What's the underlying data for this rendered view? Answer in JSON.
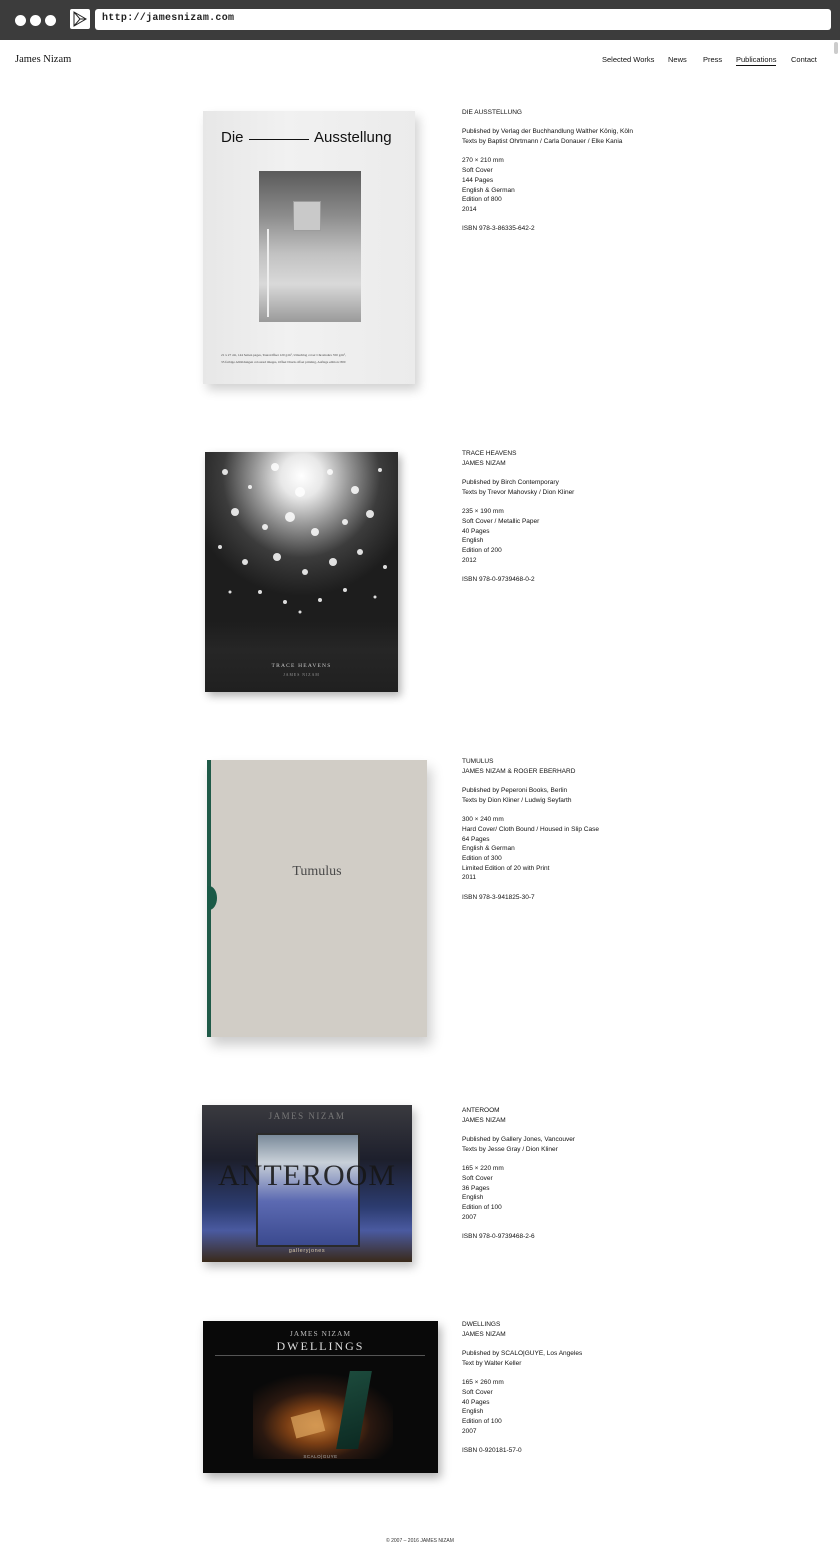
{
  "browser": {
    "url": "http://jamesnizam.com"
  },
  "site": {
    "brand": "James Nizam"
  },
  "nav": {
    "items": [
      "Selected Works",
      "News",
      "Press",
      "Publications",
      "Contact"
    ],
    "active": "Publications"
  },
  "publications": [
    {
      "cover": {
        "title_left": "Die",
        "title_right": "Ausstellung",
        "colophon_line1": "21 x 27 cm, 144 Seiten pages, TauroOffset 120 g/m², Umschlag cover Chromolux 350 g/m²,",
        "colophon_line2": "35 farbige Abbildungen coloured images, Offset Druck offset printing, Auflage edition: 800"
      },
      "title": "DIE AUSSTELLUNG",
      "author": "",
      "publisher": "Published by Verlag der Buchhandlung Walther König, Köln",
      "texts": "Texts by Baptist Ohrtmann / Carla Donauer / Elke Kania",
      "specs": [
        "270 × 210 mm",
        "Soft Cover",
        "144 Pages",
        "English & German",
        "Edition of 800",
        "2014"
      ],
      "isbn": "ISBN 978-3-86335-642-2"
    },
    {
      "cover": {
        "title": "TRACE HEAVENS",
        "author": "JAMES NIZAM"
      },
      "title": "TRACE HEAVENS",
      "author": "JAMES NIZAM",
      "publisher": "Published by Birch Contemporary",
      "texts": "Texts by Trevor Mahovsky / Dion Kliner",
      "specs": [
        "235 × 190 mm",
        "Soft Cover / Metallic Paper",
        "40 Pages",
        "English",
        "Edition of 200",
        "2012"
      ],
      "isbn": "ISBN 978-0-9739468-0-2"
    },
    {
      "cover": {
        "title": "Tumulus"
      },
      "title": "TUMULUS",
      "author": "JAMES NIZAM & ROGER EBERHARD",
      "publisher": "Published by Peperoni Books, Berlin",
      "texts": "Texts by Dion Kliner / Ludwig Seyfarth",
      "specs": [
        "300 × 240 mm",
        "Hard Cover/ Cloth Bound / Housed in Slip Case",
        "64 Pages",
        "English & German",
        "Edition of 300",
        "Limited Edition of 20 with Print",
        "2011"
      ],
      "isbn": "ISBN 978-3-941825-30-7"
    },
    {
      "cover": {
        "author": "JAMES NIZAM",
        "title": "ANTEROOM",
        "publisher": "galleryjones"
      },
      "title": "ANTEROOM",
      "author": "JAMES NIZAM",
      "publisher": "Published by Gallery Jones, Vancouver",
      "texts": "Texts by Jesse Gray / Dion Kliner",
      "specs": [
        "165 × 220 mm",
        "Soft Cover",
        "36 Pages",
        "English",
        "Edition of 100",
        "2007"
      ],
      "isbn": "ISBN 978-0-9739468-2-6"
    },
    {
      "cover": {
        "author": "JAMES NIZAM",
        "title": "DWELLINGS",
        "publisher": "SCALO|GUYE"
      },
      "title": "DWELLINGS",
      "author": "JAMES NIZAM",
      "publisher": "Published by SCALO|GUYE, Los Angeles",
      "texts": "Text by Walter Keller",
      "specs": [
        "165 × 260 mm",
        "Soft Cover",
        "40 Pages",
        "English",
        "Edition of 100",
        "2007"
      ],
      "isbn": "ISBN 0-920181-57-0"
    }
  ],
  "footer": {
    "copyright": "© 2007 – 2016 JAMES NIZAM"
  }
}
